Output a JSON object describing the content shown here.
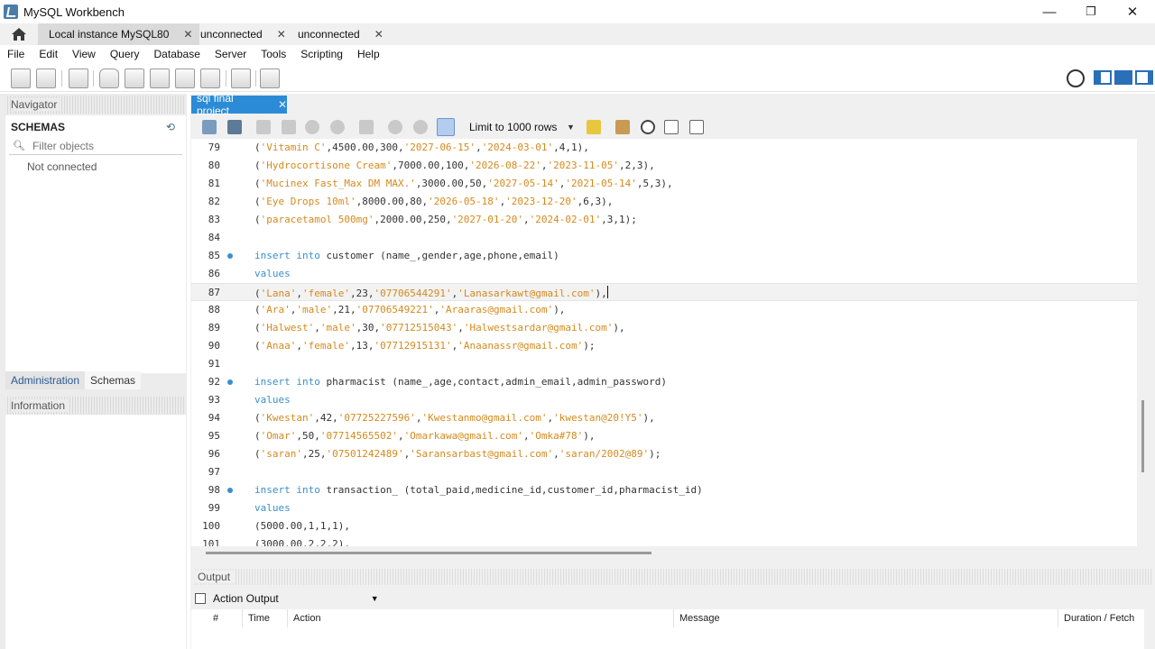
{
  "window": {
    "title": "MySQL Workbench",
    "minimize": "—",
    "restore": "❐",
    "close": "✕"
  },
  "tabs": [
    {
      "label": "Local instance MySQL80",
      "close": "✕"
    },
    {
      "label": "unconnected",
      "close": "✕"
    },
    {
      "label": "unconnected",
      "close": "✕"
    }
  ],
  "menu": [
    "File",
    "Edit",
    "View",
    "Query",
    "Database",
    "Server",
    "Tools",
    "Scripting",
    "Help"
  ],
  "navigator": {
    "header": "Navigator",
    "schemas_title": "SCHEMAS",
    "filter_placeholder": "Filter objects",
    "status": "Not connected",
    "tabs": [
      "Administration",
      "Schemas"
    ],
    "info_header": "Information"
  },
  "editor": {
    "tab_label": "sql final project",
    "tab_close": "✕",
    "limit_label": "Limit to 1000 rows",
    "lines": [
      {
        "n": "79",
        "text": "('Vitamin C',4500.00,300,'2027-06-15','2024-03-01',4,1),",
        "marker": false
      },
      {
        "n": "80",
        "text": "('Hydrocortisone Cream',7000.00,100,'2026-08-22','2023-11-05',2,3),",
        "marker": false
      },
      {
        "n": "81",
        "text": "('Mucinex Fast_Max DM MAX.',3000.00,50,'2027-05-14','2021-05-14',5,3),",
        "marker": false
      },
      {
        "n": "82",
        "text": "('Eye Drops 10ml',8000.00,80,'2026-05-18','2023-12-20',6,3),",
        "marker": false
      },
      {
        "n": "83",
        "text": "('paracetamol 500mg',2000.00,250,'2027-01-20','2024-02-01',3,1);",
        "marker": false
      },
      {
        "n": "84",
        "text": "",
        "marker": false
      },
      {
        "n": "85",
        "text": "insert into customer (name_,gender,age,phone,email)",
        "marker": true
      },
      {
        "n": "86",
        "text": "values",
        "marker": false
      },
      {
        "n": "87",
        "text": "('Lana','female',23,'07706544291','Lanasarkawt@gmail.com'),",
        "marker": false
      },
      {
        "n": "88",
        "text": "('Ara','male',21,'07706549221','Araaras@gmail.com'),",
        "marker": false
      },
      {
        "n": "89",
        "text": "('Halwest','male',30,'07712515043','Halwestsardar@gmail.com'),",
        "marker": false
      },
      {
        "n": "90",
        "text": "('Anaa','female',13,'07712915131','Anaanassr@gmail.com');",
        "marker": false
      },
      {
        "n": "91",
        "text": "",
        "marker": false
      },
      {
        "n": "92",
        "text": "insert into pharmacist (name_,age,contact,admin_email,admin_password)",
        "marker": true
      },
      {
        "n": "93",
        "text": "values",
        "marker": false
      },
      {
        "n": "94",
        "text": "('Kwestan',42,'07725227596','Kwestanmo@gmail.com','kwestan@20!Y5'),",
        "marker": false
      },
      {
        "n": "95",
        "text": "('Omar',50,'07714565502','Omarkawa@gmail.com','Omka#78'),",
        "marker": false
      },
      {
        "n": "96",
        "text": "('saran',25,'07501242489','Saransarbast@gmail.com','saran/2002@89');",
        "marker": false
      },
      {
        "n": "97",
        "text": "",
        "marker": false
      },
      {
        "n": "98",
        "text": "insert into transaction_ (total_paid,medicine_id,customer_id,pharmacist_id)",
        "marker": true
      },
      {
        "n": "99",
        "text": "values",
        "marker": false
      },
      {
        "n": "100",
        "text": "(5000.00,1,1,1),",
        "marker": false
      },
      {
        "n": "101",
        "text": "(3000.00,2,2,2),",
        "marker": false
      }
    ]
  },
  "output": {
    "header": "Output",
    "selector": "Action Output",
    "columns": [
      "#",
      "Time",
      "Action",
      "Message",
      "Duration / Fetch"
    ]
  },
  "colors": {
    "keyword": "#3c8fc8",
    "string": "#d48a1e",
    "text": "#333333",
    "accent": "#2b8bd6"
  },
  "icons": [
    "home-icon",
    "new-sql-tab-icon",
    "open-sql-script-icon",
    "inspector-icon",
    "create-schema-icon",
    "create-table-icon",
    "create-view-icon",
    "create-procedure-icon",
    "create-function-icon",
    "search-table-icon",
    "reconnect-icon",
    "shell-icon",
    "open-file-icon",
    "save-icon",
    "execute-icon",
    "execute-current-icon",
    "explain-icon",
    "stop-icon",
    "toggle-continue-icon",
    "commit-icon",
    "rollback-icon",
    "autocommit-icon",
    "add-snippet-icon",
    "beautify-icon",
    "find-icon",
    "invisible-chars-icon",
    "wrap-icon"
  ]
}
